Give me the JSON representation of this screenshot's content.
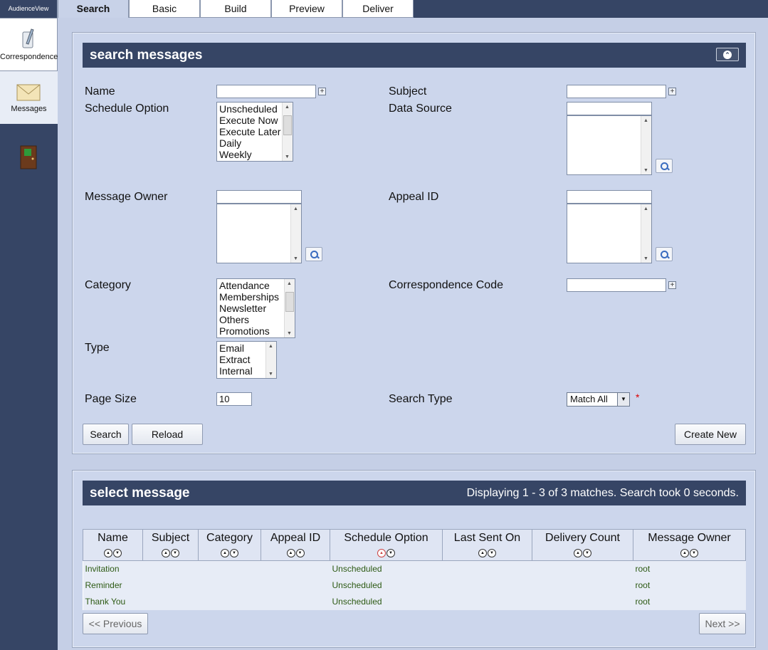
{
  "app": {
    "brand": "AudienceView"
  },
  "rail": [
    {
      "label": "Correspondence",
      "icon": "correspondence-icon"
    },
    {
      "label": "Messages",
      "icon": "envelope-icon"
    },
    {
      "label": "",
      "icon": "exit-door-icon"
    }
  ],
  "tabs": [
    "Search",
    "Basic",
    "Build",
    "Preview",
    "Deliver"
  ],
  "search_panel": {
    "title": "search messages",
    "fields": {
      "name_label": "Name",
      "name_value": "",
      "subject_label": "Subject",
      "subject_value": "",
      "schedule_label": "Schedule Option",
      "schedule_options": [
        "Unscheduled",
        "Execute Now",
        "Execute Later",
        "Daily",
        "Weekly"
      ],
      "datasource_label": "Data Source",
      "owner_label": "Message Owner",
      "appeal_label": "Appeal ID",
      "category_label": "Category",
      "category_options": [
        "Attendance",
        "Memberships",
        "Newsletter",
        "Others",
        "Promotions"
      ],
      "corr_code_label": "Correspondence Code",
      "type_label": "Type",
      "type_options": [
        "Email",
        "Extract",
        "Internal"
      ],
      "pagesize_label": "Page Size",
      "pagesize_value": "10",
      "searchtype_label": "Search Type",
      "searchtype_value": "Match All",
      "required_mark": "*"
    },
    "buttons": {
      "search": "Search",
      "reload": "Reload",
      "create_new": "Create New"
    }
  },
  "results_panel": {
    "title": "select message",
    "status": "Displaying 1 - 3 of 3 matches. Search took 0 seconds.",
    "columns": [
      "Name",
      "Subject",
      "Category",
      "Appeal ID",
      "Schedule Option",
      "Last Sent On",
      "Delivery Count",
      "Message Owner"
    ],
    "rows": [
      [
        "Invitation",
        "",
        "",
        "",
        "Unscheduled",
        "",
        "",
        "root"
      ],
      [
        "Reminder",
        "",
        "",
        "",
        "Unscheduled",
        "",
        "",
        "root"
      ],
      [
        "Thank You",
        "",
        "",
        "",
        "Unscheduled",
        "",
        "",
        "root"
      ]
    ],
    "prev": "<< Previous",
    "next": "Next >>"
  }
}
